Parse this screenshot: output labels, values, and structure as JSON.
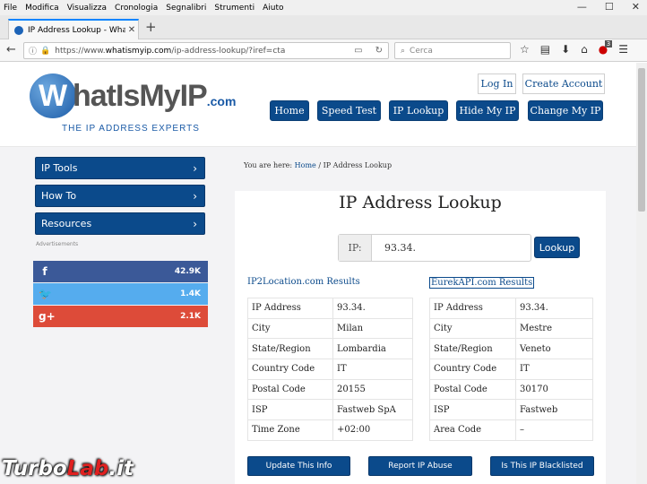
{
  "menubar": [
    "File",
    "Modifica",
    "Visualizza",
    "Cronologia",
    "Segnalibri",
    "Strumenti",
    "Aiuto"
  ],
  "window_controls": [
    "—",
    "☐",
    "✕"
  ],
  "browser": {
    "tab_title": "IP Address Lookup - WhatIsMyIP",
    "url_prefix": "https://www.",
    "url_host": "whatismyip.com",
    "url_path": "/ip-address-lookup/?iref=cta",
    "search_placeholder": "Cerca",
    "badge": "3"
  },
  "logo": {
    "letter": "W",
    "text": "hatIsMyIP",
    "tld": ".com",
    "tagline": "THE IP ADDRESS EXPERTS"
  },
  "header": {
    "login": "Log In",
    "create_account": "Create Account",
    "nav": [
      "Home",
      "Speed Test",
      "IP Lookup",
      "Hide My IP",
      "Change My IP"
    ]
  },
  "sidebar": {
    "items": [
      "IP Tools",
      "How To",
      "Resources"
    ],
    "ads_label": "Advertisements",
    "shares": [
      {
        "network": "facebook",
        "icon": "f",
        "count": "42.9K",
        "color": "#3b5998"
      },
      {
        "network": "twitter",
        "icon": "t",
        "count": "1.4K",
        "color": "#55acee"
      },
      {
        "network": "google-plus",
        "icon": "g+",
        "count": "2.1K",
        "color": "#dd4b39"
      }
    ]
  },
  "breadcrumb": {
    "prefix": "You are here:",
    "home": "Home",
    "separator": "/",
    "current": "IP Address Lookup"
  },
  "lookup": {
    "title": "IP Address Lookup",
    "ip_label": "IP:",
    "ip_value": "93.34.",
    "button": "Lookup"
  },
  "results": [
    {
      "source": "IP2Location.com Results",
      "rows": [
        [
          "IP Address",
          "93.34."
        ],
        [
          "City",
          "Milan"
        ],
        [
          "State/Region",
          "Lombardia"
        ],
        [
          "Country Code",
          "IT"
        ],
        [
          "Postal Code",
          "20155"
        ],
        [
          "ISP",
          "Fastweb SpA"
        ],
        [
          "Time Zone",
          "+02:00"
        ]
      ]
    },
    {
      "source": "EurekAPI.com Results",
      "rows": [
        [
          "IP Address",
          "93.34."
        ],
        [
          "City",
          "Mestre"
        ],
        [
          "State/Region",
          "Veneto"
        ],
        [
          "Country Code",
          "IT"
        ],
        [
          "Postal Code",
          "30170"
        ],
        [
          "ISP",
          "Fastweb"
        ],
        [
          "Area Code",
          "–"
        ]
      ]
    }
  ],
  "actions": [
    "Update This Info",
    "Report IP Abuse",
    "Is This IP Blacklisted"
  ],
  "watermark": {
    "part1": "Turbo",
    "part2": "Lab",
    "part3": ".it"
  }
}
